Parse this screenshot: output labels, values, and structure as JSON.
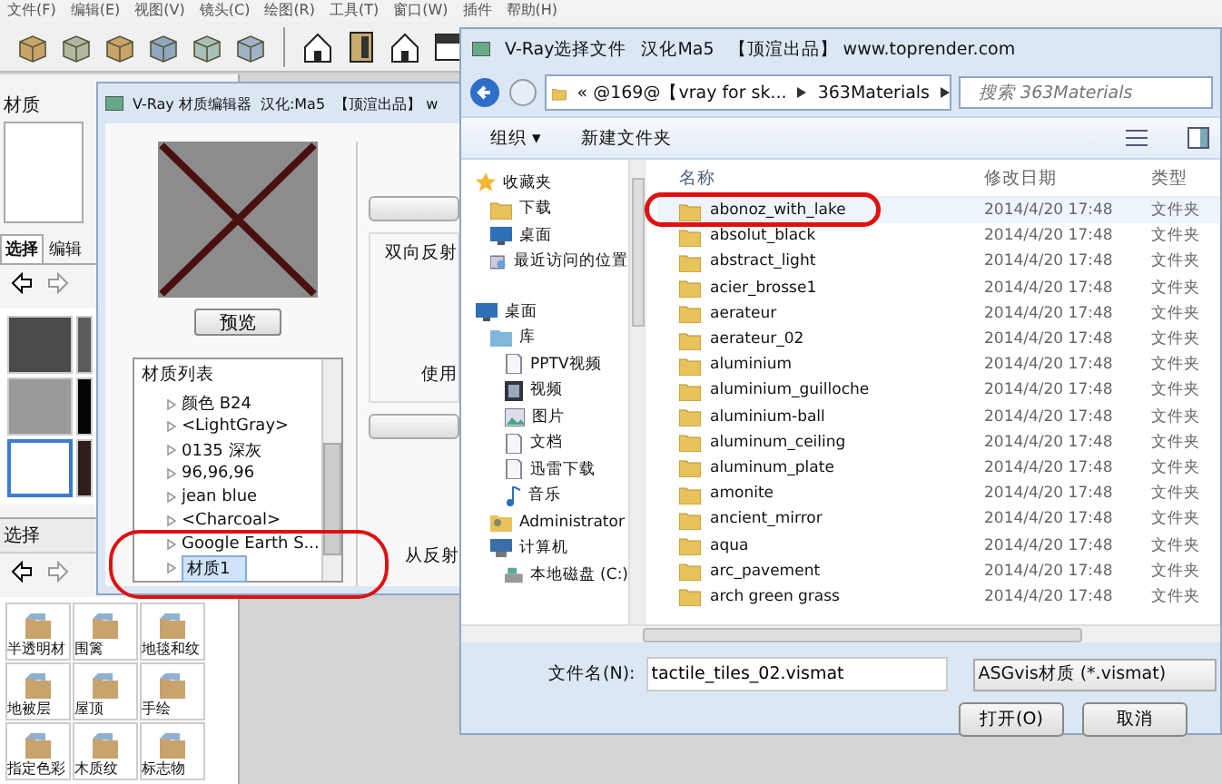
{
  "menu_bar": {
    "items": [
      "文件(F)",
      "编辑(E)",
      "视图(V)",
      "镜头(C)",
      "绘图(R)",
      "工具(T)",
      "窗口(W)",
      "插件",
      "帮助(H)"
    ]
  },
  "materials_panel": {
    "title": "材质",
    "tabs": [
      {
        "label": "选择",
        "selected": true
      },
      {
        "label": "编辑",
        "selected": false
      }
    ],
    "swatches": [
      {
        "color": "#4a4a4a",
        "selected": false
      },
      {
        "color": "#5c5c5c",
        "selected": false
      },
      {
        "color": "#9a9a9a",
        "selected": false
      },
      {
        "color": "#050505",
        "selected": false
      },
      {
        "color": "#ffffff",
        "selected": true
      },
      {
        "color": "#2e1d18",
        "selected": false
      }
    ],
    "section_title": "选择",
    "folders": [
      "半透明材",
      "围篱",
      "地毯和纹",
      "地被层",
      "屋顶",
      "手绘",
      "指定色彩",
      "木质纹",
      "标志物"
    ]
  },
  "material_editor": {
    "title": "V-Ray 材质编辑器",
    "credit": "汉化:Ma5",
    "publisher": "【顶渲出品】 w",
    "preview_button": "预览",
    "list": {
      "title": "材质列表",
      "items": [
        {
          "label": "颜色 B24",
          "selected": false
        },
        {
          "label": "<LightGray>",
          "selected": false
        },
        {
          "label": "0135 深灰",
          "selected": false
        },
        {
          "label": "96,96,96",
          "selected": false
        },
        {
          "label": "jean blue",
          "selected": false
        },
        {
          "label": "<Charcoal>",
          "selected": false
        },
        {
          "label": "Google Earth S...",
          "selected": false
        },
        {
          "label": "材质1",
          "selected": true
        }
      ]
    },
    "labels": [
      "双向反射",
      "使用",
      "从反射"
    ]
  },
  "file_dialog": {
    "title": "V-Ray选择文件",
    "credit": "汉化Ma5",
    "publisher": "【顶渲出品】 www.toprender.com",
    "breadcrumb": [
      "« @169@【vray for sk...",
      "363Materials"
    ],
    "search": {
      "placeholder": "搜索 363Materials"
    },
    "toolbar": [
      "组织 ▾",
      "新建文件夹"
    ],
    "nav": [
      {
        "label": "收藏夹",
        "kind": "star",
        "children": [
          {
            "label": "下载",
            "kind": "folder"
          },
          {
            "label": "桌面",
            "kind": "desktop"
          },
          {
            "label": "最近访问的位置",
            "kind": "recent"
          }
        ]
      },
      {
        "label": "桌面",
        "kind": "desktop",
        "children": [
          {
            "label": "库",
            "kind": "library",
            "children": [
              {
                "label": "PPTV视频",
                "kind": "doc"
              },
              {
                "label": "视频",
                "kind": "video"
              },
              {
                "label": "图片",
                "kind": "picture"
              },
              {
                "label": "文档",
                "kind": "doc"
              },
              {
                "label": "迅雷下载",
                "kind": "doc"
              },
              {
                "label": "音乐",
                "kind": "music"
              }
            ]
          },
          {
            "label": "Administrator",
            "kind": "user"
          },
          {
            "label": "计算机",
            "kind": "computer",
            "children": [
              {
                "label": "本地磁盘 (C:)",
                "kind": "drive"
              }
            ]
          }
        ]
      }
    ],
    "columns": [
      "名称",
      "修改日期",
      "类型"
    ],
    "rows": [
      {
        "name": "abonoz_with_lake",
        "date": "2014/4/20 17:48",
        "type": "文件夹",
        "selected": true
      },
      {
        "name": "absolut_black",
        "date": "2014/4/20 17:48",
        "type": "文件夹",
        "selected": false
      },
      {
        "name": "abstract_light",
        "date": "2014/4/20 17:48",
        "type": "文件夹",
        "selected": false
      },
      {
        "name": "acier_brosse1",
        "date": "2014/4/20 17:48",
        "type": "文件夹",
        "selected": false
      },
      {
        "name": "aerateur",
        "date": "2014/4/20 17:48",
        "type": "文件夹",
        "selected": false
      },
      {
        "name": "aerateur_02",
        "date": "2014/4/20 17:48",
        "type": "文件夹",
        "selected": false
      },
      {
        "name": "aluminium",
        "date": "2014/4/20 17:48",
        "type": "文件夹",
        "selected": false
      },
      {
        "name": "aluminium_guilloche",
        "date": "2014/4/20 17:48",
        "type": "文件夹",
        "selected": false
      },
      {
        "name": "aluminium-ball",
        "date": "2014/4/20 17:48",
        "type": "文件夹",
        "selected": false
      },
      {
        "name": "aluminum_ceiling",
        "date": "2014/4/20 17:48",
        "type": "文件夹",
        "selected": false
      },
      {
        "name": "aluminum_plate",
        "date": "2014/4/20 17:48",
        "type": "文件夹",
        "selected": false
      },
      {
        "name": "amonite",
        "date": "2014/4/20 17:48",
        "type": "文件夹",
        "selected": false
      },
      {
        "name": "ancient_mirror",
        "date": "2014/4/20 17:48",
        "type": "文件夹",
        "selected": false
      },
      {
        "name": "aqua",
        "date": "2014/4/20 17:48",
        "type": "文件夹",
        "selected": false
      },
      {
        "name": "arc_pavement",
        "date": "2014/4/20 17:48",
        "type": "文件夹",
        "selected": false
      },
      {
        "name": "arch green grass",
        "date": "2014/4/20 17:48",
        "type": "文件夹",
        "selected": false
      }
    ],
    "filename_label": "文件名(N):",
    "filename": "tactile_tiles_02.vismat",
    "filter": "ASGvis材质 (*.vismat)",
    "buttons": [
      "打开(O)",
      "取消"
    ]
  }
}
